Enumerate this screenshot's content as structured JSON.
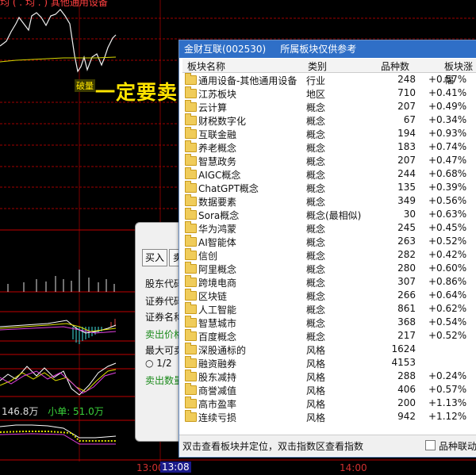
{
  "header": {
    "text": "均  ( . 均  . )  其他通用设备"
  },
  "annotation": {
    "tag": "破量",
    "text": "一定要卖，"
  },
  "volume": {
    "label": "146.8万",
    "small_label": "小单: 51.0万"
  },
  "timebar": {
    "t1": "13:00",
    "current": "13:08",
    "t2": "14:00"
  },
  "trade_panel": {
    "buy_label": "买入",
    "sell_label": "卖",
    "lines": [
      "股东代码",
      "证券代码",
      "证券名称",
      "卖出价格",
      "最大可卖",
      "1/2",
      "卖出数量"
    ]
  },
  "dialog": {
    "title": "金财互联(002530)",
    "subtitle": "所属板块仅供参考",
    "columns": [
      "板块名称",
      "类别",
      "品种数",
      "板块涨幅"
    ],
    "rows": [
      {
        "name": "通用设备-其他通用设备",
        "type": "行业",
        "count": "248",
        "change": "+0.57%"
      },
      {
        "name": "江苏板块",
        "type": "地区",
        "count": "710",
        "change": "+0.41%"
      },
      {
        "name": "云计算",
        "type": "概念",
        "count": "207",
        "change": "+0.49%"
      },
      {
        "name": "财税数字化",
        "type": "概念",
        "count": "67",
        "change": "+0.34%"
      },
      {
        "name": "互联金融",
        "type": "概念",
        "count": "194",
        "change": "+0.93%"
      },
      {
        "name": "养老概念",
        "type": "概念",
        "count": "183",
        "change": "+0.74%"
      },
      {
        "name": "智慧政务",
        "type": "概念",
        "count": "207",
        "change": "+0.47%"
      },
      {
        "name": "AIGC概念",
        "type": "概念",
        "count": "244",
        "change": "+0.68%"
      },
      {
        "name": "ChatGPT概念",
        "type": "概念",
        "count": "135",
        "change": "+0.39%"
      },
      {
        "name": "数据要素",
        "type": "概念",
        "count": "349",
        "change": "+0.56%"
      },
      {
        "name": "Sora概念",
        "type": "概念(最相似)",
        "count": "30",
        "change": "+0.63%"
      },
      {
        "name": "华为鸿蒙",
        "type": "概念",
        "count": "245",
        "change": "+0.45%"
      },
      {
        "name": "AI智能体",
        "type": "概念",
        "count": "263",
        "change": "+0.52%"
      },
      {
        "name": "信创",
        "type": "概念",
        "count": "282",
        "change": "+0.42%"
      },
      {
        "name": "阿里概念",
        "type": "概念",
        "count": "280",
        "change": "+0.60%"
      },
      {
        "name": "跨境电商",
        "type": "概念",
        "count": "307",
        "change": "+0.86%"
      },
      {
        "name": "区块链",
        "type": "概念",
        "count": "266",
        "change": "+0.64%"
      },
      {
        "name": "人工智能",
        "type": "概念",
        "count": "861",
        "change": "+0.62%"
      },
      {
        "name": "智慧城市",
        "type": "概念",
        "count": "368",
        "change": "+0.54%"
      },
      {
        "name": "百度概念",
        "type": "概念",
        "count": "217",
        "change": "+0.52%"
      },
      {
        "name": "深股通标的",
        "type": "风格",
        "count": "1624",
        "change": ""
      },
      {
        "name": "融资融券",
        "type": "风格",
        "count": "4153",
        "change": ""
      },
      {
        "name": "股东减持",
        "type": "风格",
        "count": "288",
        "change": "+0.24%"
      },
      {
        "name": "商誉减值",
        "type": "风格",
        "count": "406",
        "change": "+0.57%"
      },
      {
        "name": "高市盈率",
        "type": "风格",
        "count": "200",
        "change": "+1.13%"
      },
      {
        "name": "连续亏损",
        "type": "风格",
        "count": "942",
        "change": "+1.12%"
      }
    ],
    "status_text": "双击查看板块并定位，双击指数区查看指数",
    "checkbox_label": "品种联动"
  }
}
